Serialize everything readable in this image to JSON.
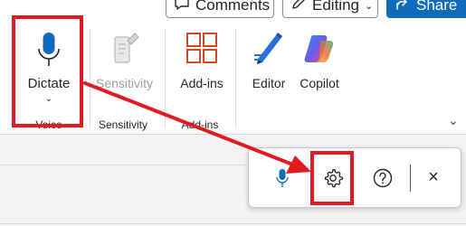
{
  "toolbar": {
    "comments_label": "Comments",
    "editing_label": "Editing",
    "share_label": "Share"
  },
  "ribbon": {
    "items": {
      "dictate": "Dictate",
      "sensitivity": "Sensitivity",
      "addins": "Add-ins",
      "editor": "Editor",
      "copilot": "Copilot"
    },
    "groups": {
      "voice": "Voice",
      "sensitivity": "Sensitivity",
      "addins": "Add-ins"
    }
  },
  "dictation_toolbar": {
    "close_glyph": "×"
  },
  "colors": {
    "accent": "#0f6cbd",
    "highlight": "#e01b22",
    "addins_orange": "#d24726"
  }
}
